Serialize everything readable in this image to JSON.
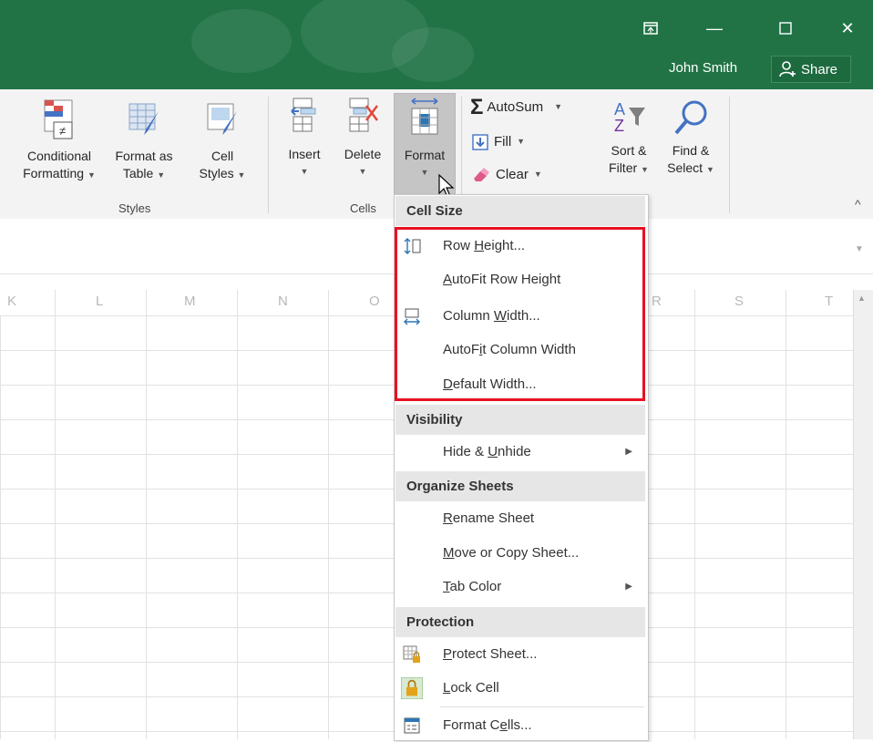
{
  "window": {
    "user_name": "John Smith",
    "share_label": "Share",
    "restore_icon": "ribbon-display-icon",
    "minimize_glyph": "—",
    "maximize_glyph": "☐",
    "close_glyph": "✕"
  },
  "ribbon": {
    "styles": {
      "group_label": "Styles",
      "buttons": [
        {
          "line1": "Conditional",
          "line2": "Formatting"
        },
        {
          "line1": "Format as",
          "line2": "Table"
        },
        {
          "line1": "Cell",
          "line2": "Styles"
        }
      ]
    },
    "cells": {
      "group_label": "Cells",
      "buttons": [
        {
          "label": "Insert"
        },
        {
          "label": "Delete"
        },
        {
          "label": "Format"
        }
      ]
    },
    "editing": {
      "autosum": "AutoSum",
      "fill": "Fill",
      "clear": "Clear",
      "sort_line1": "Sort &",
      "sort_line2": "Filter",
      "find_line1": "Find &",
      "find_line2": "Select"
    },
    "collapse_glyph": "^"
  },
  "sheet": {
    "columns": [
      "K",
      "L",
      "M",
      "N",
      "O",
      "R",
      "S",
      "T"
    ]
  },
  "menu": {
    "sections": {
      "cell_size": "Cell Size",
      "visibility": "Visibility",
      "organize": "Organize Sheets",
      "protection": "Protection"
    },
    "items": {
      "row_height": {
        "pre": "Row ",
        "ul": "H",
        "post": "eight..."
      },
      "autofit_row": {
        "pre": "",
        "ul": "A",
        "post": "utoFit Row Height"
      },
      "column_width": {
        "pre": "Column ",
        "ul": "W",
        "post": "idth..."
      },
      "autofit_col": {
        "pre": "AutoF",
        "ul": "i",
        "post": "t Column Width"
      },
      "default_width": {
        "pre": "",
        "ul": "D",
        "post": "efault Width..."
      },
      "hide_unhide": {
        "pre": "Hide & ",
        "ul": "U",
        "post": "nhide"
      },
      "rename": {
        "pre": "",
        "ul": "R",
        "post": "ename Sheet"
      },
      "move_copy": {
        "pre": "",
        "ul": "M",
        "post": "ove or Copy Sheet..."
      },
      "tab_color": {
        "pre": "",
        "ul": "T",
        "post": "ab Color"
      },
      "protect_sheet": {
        "pre": "",
        "ul": "P",
        "post": "rotect Sheet..."
      },
      "lock_cell": {
        "pre": "",
        "ul": "L",
        "post": "ock Cell"
      },
      "format_cells": {
        "pre": "Format C",
        "ul": "e",
        "post": "lls..."
      }
    },
    "submenu_glyph": "▶"
  },
  "colors": {
    "titlebar": "#217346",
    "highlight": "#e81123"
  }
}
